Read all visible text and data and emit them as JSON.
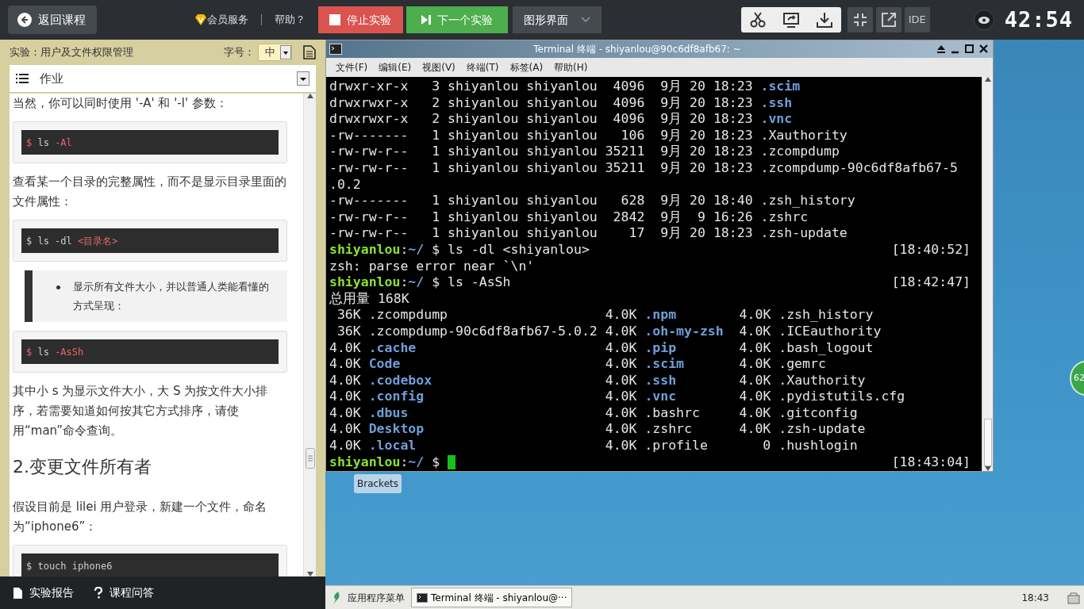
{
  "topbar": {
    "back": "返回课程",
    "vip": "会员服务",
    "help": "帮助？",
    "stop": "停止实验",
    "next": "下一个实验",
    "mode": "图形界面",
    "ide": "IDE",
    "timer": "42:54"
  },
  "lesson": {
    "title": "实验：用户及文件权限管理",
    "font_label": "字号：",
    "font_size": "中",
    "section": "作业",
    "content": [
      {
        "kind": "paragraph",
        "text": "当然，你可以同时使用 '-A' 和 '-l' 参数："
      },
      {
        "kind": "code",
        "segments": [
          {
            "text": "$",
            "kind": "accent"
          },
          {
            "text": " ls ",
            "kind": "plain"
          },
          {
            "text": "-Al",
            "kind": "accent"
          }
        ]
      },
      {
        "kind": "paragraph",
        "text": "查看某一个目录的完整属性，而不是显示目录里面的文件属性："
      },
      {
        "kind": "code",
        "segments": [
          {
            "text": "$ ls -dl ",
            "kind": "plain"
          },
          {
            "text": "<目录名>",
            "kind": "accent"
          }
        ]
      },
      {
        "kind": "quote",
        "text": "显示所有文件大小，并以普通人类能看懂的方式呈现："
      },
      {
        "kind": "code",
        "segments": [
          {
            "text": "$",
            "kind": "accent"
          },
          {
            "text": " ls ",
            "kind": "plain"
          },
          {
            "text": "-AsSh",
            "kind": "accent"
          }
        ]
      },
      {
        "kind": "paragraph",
        "text": "其中小 s 为显示文件大小，大 S 为按文件大小排序，若需要知道如何按其它方式排序，请使用“man”命令查询。"
      },
      {
        "kind": "heading",
        "text": "2.变更文件所有者"
      },
      {
        "kind": "paragraph",
        "text": "假设目前是 lilei 用户登录，新建一个文件，命名为“iphone6”："
      },
      {
        "kind": "code",
        "segments": [
          {
            "text": "$ touch iphone6",
            "kind": "plain"
          }
        ]
      }
    ]
  },
  "bottom_left": [
    {
      "label": "实验报告"
    },
    {
      "label": "课程问答"
    }
  ],
  "terminal": {
    "title": "Terminal 终端 - shiyanlou@90c6df8afb67: ~",
    "menu": [
      "文件(F)",
      "编辑(E)",
      "视图(V)",
      "终端(T)",
      "标签(A)",
      "帮助(H)"
    ],
    "lines": [
      {
        "segments": [
          {
            "text": "drwxr-xr-x   3 shiyanlou shiyanlou  4096  9月 20 18:23 ",
            "kind": "plain"
          },
          {
            "text": ".scim",
            "kind": "dir"
          }
        ]
      },
      {
        "segments": [
          {
            "text": "drwxrwxr-x   2 shiyanlou shiyanlou  4096  9月 20 18:23 ",
            "kind": "plain"
          },
          {
            "text": ".ssh",
            "kind": "dir"
          }
        ]
      },
      {
        "segments": [
          {
            "text": "drwxrwxr-x   2 shiyanlou shiyanlou  4096  9月 20 18:23 ",
            "kind": "plain"
          },
          {
            "text": ".vnc",
            "kind": "dir"
          }
        ]
      },
      {
        "segments": [
          {
            "text": "-rw-------   1 shiyanlou shiyanlou   106  9月 20 18:23 .Xauthority",
            "kind": "plain"
          }
        ]
      },
      {
        "segments": [
          {
            "text": "-rw-rw-r--   1 shiyanlou shiyanlou 35211  9月 20 18:23 .zcompdump",
            "kind": "plain"
          }
        ]
      },
      {
        "segments": [
          {
            "text": "-rw-rw-r--   1 shiyanlou shiyanlou 35211  9月 20 18:23 .zcompdump-90c6df8afb67-5",
            "kind": "plain"
          }
        ]
      },
      {
        "segments": [
          {
            "text": ".0.2",
            "kind": "plain"
          }
        ]
      },
      {
        "segments": [
          {
            "text": "-rw-------   1 shiyanlou shiyanlou   628  9月 20 18:40 .zsh_history",
            "kind": "plain"
          }
        ]
      },
      {
        "segments": [
          {
            "text": "-rw-rw-r--   1 shiyanlou shiyanlou  2842  9月  9 16:26 .zshrc",
            "kind": "plain"
          }
        ]
      },
      {
        "segments": [
          {
            "text": "-rw-rw-r--   1 shiyanlou shiyanlou    17  9月 20 18:23 .zsh-update",
            "kind": "plain"
          }
        ]
      },
      {
        "segments": [
          {
            "text": "shiyanlou",
            "kind": "user"
          },
          {
            "text": ":",
            "kind": "plain"
          },
          {
            "text": "~/",
            "kind": "path"
          },
          {
            "text": " $ ls -dl <shiyanlou>",
            "kind": "plain"
          }
        ],
        "time": "[18:40:52]"
      },
      {
        "segments": [
          {
            "text": "zsh: parse error near `\\n'",
            "kind": "plain"
          }
        ]
      },
      {
        "segments": [
          {
            "text": "shiyanlou",
            "kind": "user"
          },
          {
            "text": ":",
            "kind": "plain"
          },
          {
            "text": "~/",
            "kind": "path"
          },
          {
            "text": " $ ls -AsSh",
            "kind": "plain"
          }
        ],
        "time": "[18:42:47]"
      },
      {
        "segments": [
          {
            "text": "总用量 168K",
            "kind": "plain"
          }
        ]
      },
      {
        "segments": [
          {
            "text": " 36K .zcompdump                    4.0K ",
            "kind": "plain"
          },
          {
            "text": ".npm",
            "kind": "dir"
          },
          {
            "text": "        4.0K .zsh_history",
            "kind": "plain"
          }
        ]
      },
      {
        "segments": [
          {
            "text": " 36K .zcompdump-90c6df8afb67-5.0.2 4.0K ",
            "kind": "plain"
          },
          {
            "text": ".oh-my-zsh",
            "kind": "dir"
          },
          {
            "text": "  4.0K .ICEauthority",
            "kind": "plain"
          }
        ]
      },
      {
        "segments": [
          {
            "text": "4.0K ",
            "kind": "plain"
          },
          {
            "text": ".cache",
            "kind": "dir"
          },
          {
            "text": "                        4.0K ",
            "kind": "plain"
          },
          {
            "text": ".pip",
            "kind": "dir"
          },
          {
            "text": "        4.0K .bash_logout",
            "kind": "plain"
          }
        ]
      },
      {
        "segments": [
          {
            "text": "4.0K ",
            "kind": "plain"
          },
          {
            "text": "Code",
            "kind": "dir"
          },
          {
            "text": "                          4.0K ",
            "kind": "plain"
          },
          {
            "text": ".scim",
            "kind": "dir"
          },
          {
            "text": "       4.0K .gemrc",
            "kind": "plain"
          }
        ]
      },
      {
        "segments": [
          {
            "text": "4.0K ",
            "kind": "plain"
          },
          {
            "text": ".codebox",
            "kind": "dir"
          },
          {
            "text": "                      4.0K ",
            "kind": "plain"
          },
          {
            "text": ".ssh",
            "kind": "dir"
          },
          {
            "text": "        4.0K .Xauthority",
            "kind": "plain"
          }
        ]
      },
      {
        "segments": [
          {
            "text": "4.0K ",
            "kind": "plain"
          },
          {
            "text": ".config",
            "kind": "dir"
          },
          {
            "text": "                       4.0K ",
            "kind": "plain"
          },
          {
            "text": ".vnc",
            "kind": "dir"
          },
          {
            "text": "        4.0K .pydistutils.cfg",
            "kind": "plain"
          }
        ]
      },
      {
        "segments": [
          {
            "text": "4.0K ",
            "kind": "plain"
          },
          {
            "text": ".dbus",
            "kind": "dir"
          },
          {
            "text": "                         4.0K .bashrc     4.0K .gitconfig",
            "kind": "plain"
          }
        ]
      },
      {
        "segments": [
          {
            "text": "4.0K ",
            "kind": "plain"
          },
          {
            "text": "Desktop",
            "kind": "dir"
          },
          {
            "text": "                       4.0K .zshrc      4.0K .zsh-update",
            "kind": "plain"
          }
        ]
      },
      {
        "segments": [
          {
            "text": "4.0K ",
            "kind": "plain"
          },
          {
            "text": ".local",
            "kind": "dir"
          },
          {
            "text": "                        4.0K .profile       0 .hushlogin",
            "kind": "plain"
          }
        ]
      },
      {
        "segments": [
          {
            "text": "shiyanlou",
            "kind": "user"
          },
          {
            "text": ":",
            "kind": "plain"
          },
          {
            "text": "~/",
            "kind": "path"
          },
          {
            "text": " $ ",
            "kind": "plain"
          }
        ],
        "time": "[18:43:04]",
        "cursor": true
      }
    ]
  },
  "desktop": {
    "icon_label": "Brackets",
    "badge": "62"
  },
  "taskbar": {
    "menu": "应用程序菜单",
    "task": "Terminal 终端 - shiyanlou@···",
    "clock": "18:43"
  }
}
